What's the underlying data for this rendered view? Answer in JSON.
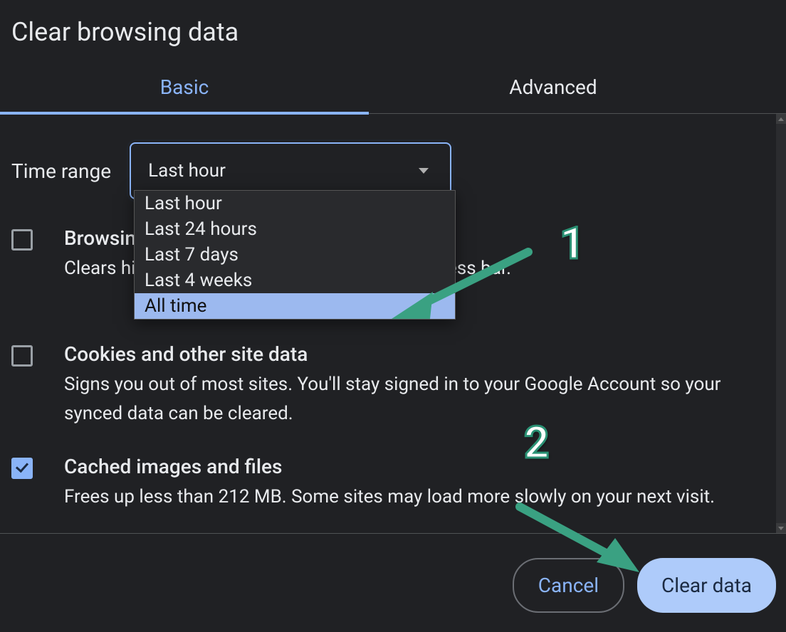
{
  "title": "Clear browsing data",
  "tabs": {
    "basic": "Basic",
    "advanced": "Advanced"
  },
  "time_range": {
    "label": "Time range",
    "selected": "Last hour",
    "options": [
      "Last hour",
      "Last 24 hours",
      "Last 7 days",
      "Last 4 weeks",
      "All time"
    ]
  },
  "items": {
    "browsing": {
      "title": "Browsing history",
      "desc": "Clears history and autocompletions in the address bar.",
      "checked": false
    },
    "cookies": {
      "title": "Cookies and other site data",
      "desc": "Signs you out of most sites. You'll stay signed in to your Google Account so your synced data can be cleared.",
      "checked": false
    },
    "cache": {
      "title": "Cached images and files",
      "desc": "Frees up less than 212 MB. Some sites may load more slowly on your next visit.",
      "checked": true
    }
  },
  "buttons": {
    "cancel": "Cancel",
    "clear": "Clear data"
  },
  "annotations": {
    "one": "1",
    "two": "2"
  }
}
